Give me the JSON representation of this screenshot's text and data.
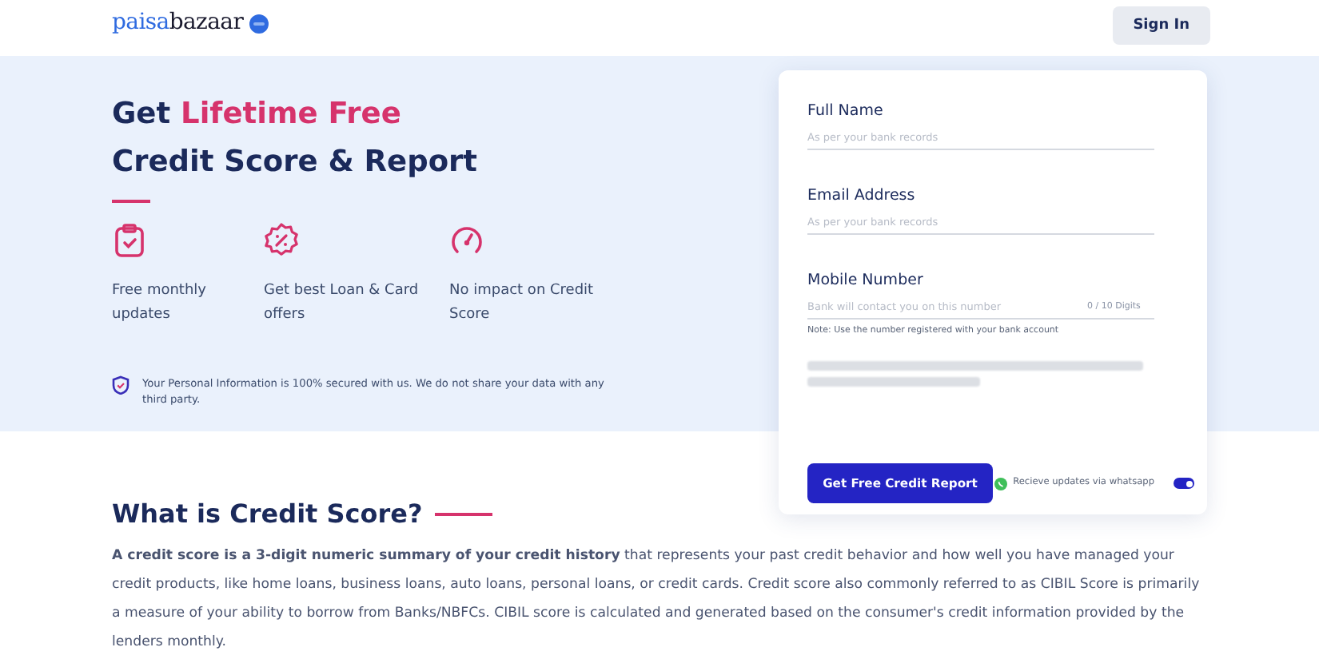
{
  "header": {
    "logo": {
      "primary": "paisa",
      "secondary": "bazaar"
    },
    "sign_in": "Sign In"
  },
  "hero": {
    "title": {
      "lead": "Get ",
      "highlight": "Lifetime Free",
      "line2": "Credit Score & Report"
    },
    "features": [
      {
        "kind": "clipboard",
        "text": "Free monthly updates"
      },
      {
        "kind": "offer",
        "text": "Get best Loan & Card offers"
      },
      {
        "kind": "gauge",
        "text": "No impact on Credit Score"
      }
    ],
    "security_note": "Your Personal Information is 100% secured with us. We do not share your data with any third party."
  },
  "form": {
    "fields": [
      {
        "label": "Full Name",
        "placeholder": "As per your bank records"
      },
      {
        "label": "Email Address",
        "placeholder": "As per your bank records"
      },
      {
        "label": "Mobile Number",
        "placeholder": "Bank will contact you on this number",
        "counter": "0 / 10 Digits",
        "note": "Note: Use the number registered with your bank account"
      }
    ],
    "submit": "Get Free Credit Report",
    "whatsapp": {
      "label": "Recieve updates via whatsapp",
      "on": true
    }
  },
  "about": {
    "heading": "What is Credit Score?",
    "text": "**A credit score is a 3-digit numeric summary of your credit history** that represents your past credit behavior and how well you have managed your credit products, like home loans, business loans, auto loans, personal loans, or credit cards. Credit score also commonly referred to as CIBIL Score is primarily a measure of your ability to borrow from Banks/NBFCs. CIBIL score is calculated and generated based on the consumer's credit information provided by the lenders monthly."
  }
}
